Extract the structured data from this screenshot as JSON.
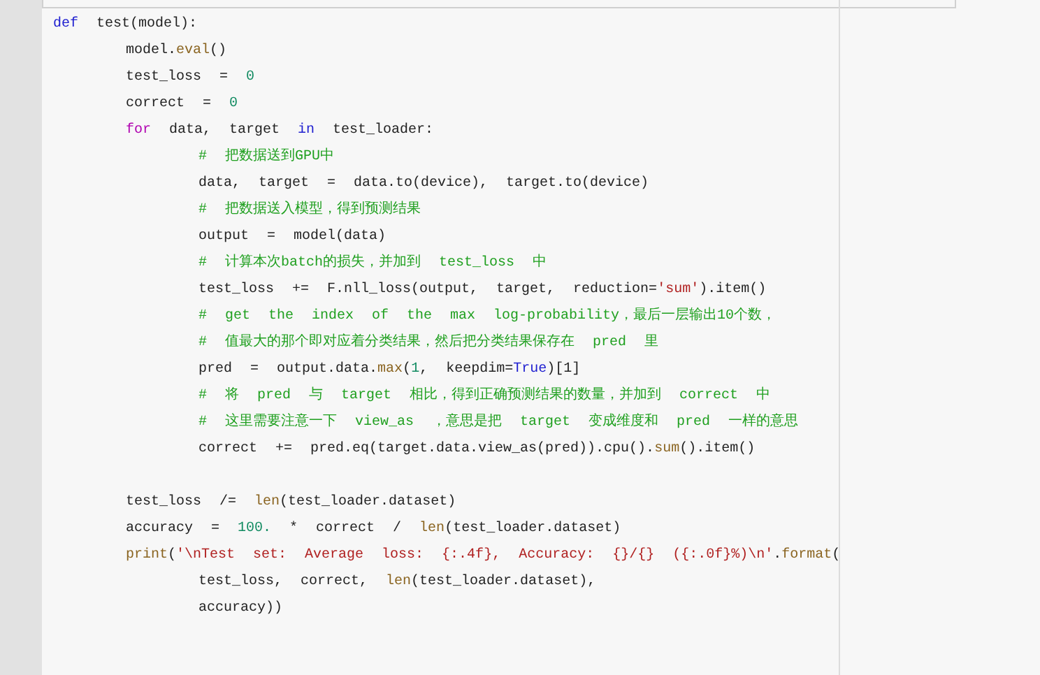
{
  "editor": {
    "lines": [
      {
        "kind": "code",
        "tokens": [
          {
            "text": "def",
            "kind": "keyword"
          },
          {
            "text": " test(model):",
            "kind": "plain"
          }
        ]
      },
      {
        "kind": "code",
        "tokens": [
          {
            "text": "    model.",
            "kind": "plain"
          },
          {
            "text": "eval",
            "kind": "builtin"
          },
          {
            "text": "()",
            "kind": "plain"
          }
        ]
      },
      {
        "kind": "code",
        "tokens": [
          {
            "text": "    test_loss = ",
            "kind": "plain"
          },
          {
            "text": "0",
            "kind": "number"
          }
        ]
      },
      {
        "kind": "code",
        "tokens": [
          {
            "text": "    correct = ",
            "kind": "plain"
          },
          {
            "text": "0",
            "kind": "number"
          }
        ]
      },
      {
        "kind": "code",
        "tokens": [
          {
            "text": "    for",
            "kind": "flow"
          },
          {
            "text": " data, target ",
            "kind": "plain"
          },
          {
            "text": "in",
            "kind": "keyword"
          },
          {
            "text": " test_loader:",
            "kind": "plain"
          }
        ]
      },
      {
        "kind": "code",
        "tokens": [
          {
            "text": "        # 把数据送到GPU中",
            "kind": "comment"
          }
        ]
      },
      {
        "kind": "code",
        "tokens": [
          {
            "text": "        data, target = data.to(device), target.to(device)",
            "kind": "plain"
          }
        ]
      },
      {
        "kind": "code",
        "tokens": [
          {
            "text": "        # 把数据送入模型，得到预测结果",
            "kind": "comment"
          }
        ]
      },
      {
        "kind": "code",
        "tokens": [
          {
            "text": "        output = model(data)",
            "kind": "plain"
          }
        ]
      },
      {
        "kind": "code",
        "tokens": [
          {
            "text": "        # 计算本次batch的损失，并加到 test_loss 中",
            "kind": "comment"
          }
        ]
      },
      {
        "kind": "code",
        "tokens": [
          {
            "text": "        test_loss += F.nll_loss(output, target, reduction=",
            "kind": "plain"
          },
          {
            "text": "'sum'",
            "kind": "string"
          },
          {
            "text": ").item()",
            "kind": "plain"
          }
        ]
      },
      {
        "kind": "code",
        "tokens": [
          {
            "text": "        # get the index of the max log-probability，最后一层输出10个数，",
            "kind": "comment"
          }
        ]
      },
      {
        "kind": "code",
        "tokens": [
          {
            "text": "        # 值最大的那个即对应着分类结果，然后把分类结果保存在 pred 里",
            "kind": "comment"
          }
        ]
      },
      {
        "kind": "code",
        "tokens": [
          {
            "text": "        pred = output.data.",
            "kind": "plain"
          },
          {
            "text": "max",
            "kind": "builtin"
          },
          {
            "text": "(",
            "kind": "plain"
          },
          {
            "text": "1",
            "kind": "number"
          },
          {
            "text": ", keepdim=",
            "kind": "plain"
          },
          {
            "text": "True",
            "kind": "keyword"
          },
          {
            "text": ")[1]",
            "kind": "plain"
          }
        ]
      },
      {
        "kind": "code",
        "tokens": [
          {
            "text": "        # 将 pred 与 target 相比，得到正确预测结果的数量，并加到 correct 中",
            "kind": "comment"
          }
        ]
      },
      {
        "kind": "code",
        "tokens": [
          {
            "text": "        # 这里需要注意一下 view_as ，意思是把 target 变成维度和 pred 一样的意思",
            "kind": "comment"
          }
        ]
      },
      {
        "kind": "code",
        "tokens": [
          {
            "text": "        correct += pred.eq(target.data.view_as(pred)).cpu().",
            "kind": "plain"
          },
          {
            "text": "sum",
            "kind": "builtin"
          },
          {
            "text": "().item()",
            "kind": "plain"
          }
        ]
      },
      {
        "kind": "blank"
      },
      {
        "kind": "code",
        "tokens": [
          {
            "text": "    test_loss /= ",
            "kind": "plain"
          },
          {
            "text": "len",
            "kind": "builtin"
          },
          {
            "text": "(test_loader.dataset)",
            "kind": "plain"
          }
        ]
      },
      {
        "kind": "code",
        "tokens": [
          {
            "text": "    accuracy = ",
            "kind": "plain"
          },
          {
            "text": "100.",
            "kind": "number"
          },
          {
            "text": " * correct / ",
            "kind": "plain"
          },
          {
            "text": "len",
            "kind": "builtin"
          },
          {
            "text": "(test_loader.dataset)",
            "kind": "plain"
          }
        ]
      },
      {
        "kind": "code",
        "tokens": [
          {
            "text": "    print",
            "kind": "builtin"
          },
          {
            "text": "(",
            "kind": "plain"
          },
          {
            "text": "'\\nTest set: Average loss: {:.4f}, Accuracy: {}/{} ({:.0f}%)\\n'",
            "kind": "string"
          },
          {
            "text": ".",
            "kind": "plain"
          },
          {
            "text": "format",
            "kind": "builtin"
          },
          {
            "text": "(",
            "kind": "plain"
          }
        ]
      },
      {
        "kind": "code",
        "tokens": [
          {
            "text": "        test_loss, correct, ",
            "kind": "plain"
          },
          {
            "text": "len",
            "kind": "builtin"
          },
          {
            "text": "(test_loader.dataset),",
            "kind": "plain"
          }
        ]
      },
      {
        "kind": "code",
        "tokens": [
          {
            "text": "        accuracy))",
            "kind": "plain"
          }
        ]
      }
    ]
  }
}
